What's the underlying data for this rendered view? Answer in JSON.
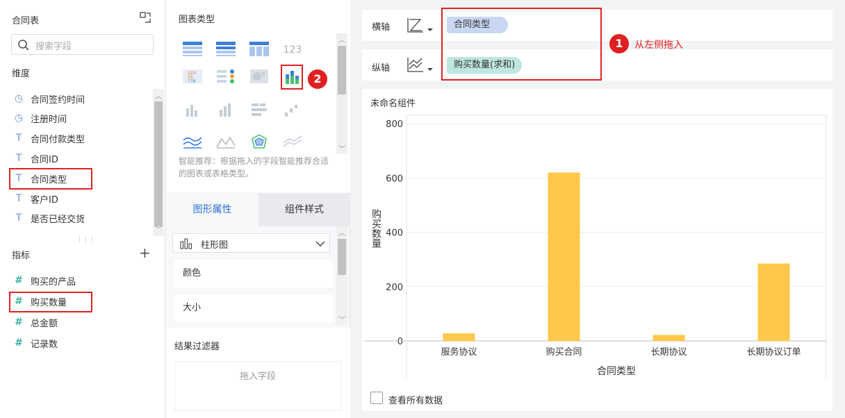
{
  "left": {
    "title": "合同表",
    "search_placeholder": "搜索字段",
    "dimensions_label": "维度",
    "dimensions": [
      {
        "icon": "clock-icon",
        "label": "合同签约时间"
      },
      {
        "icon": "clock-icon",
        "label": "注册时间"
      },
      {
        "icon": "text-type-icon",
        "label": "合同付款类型"
      },
      {
        "icon": "text-type-icon",
        "label": "合同ID"
      },
      {
        "icon": "text-type-icon",
        "label": "合同类型"
      },
      {
        "icon": "text-type-icon",
        "label": "客户ID"
      },
      {
        "icon": "text-type-icon",
        "label": "是否已经交货"
      }
    ],
    "measures_label": "指标",
    "measures": [
      {
        "icon": "hash-icon",
        "label": "购买的产品"
      },
      {
        "icon": "hash-icon",
        "label": "购买数量"
      },
      {
        "icon": "hash-icon",
        "label": "总金额"
      },
      {
        "icon": "hash-icon",
        "label": "记录数"
      }
    ]
  },
  "middle": {
    "chart_types_label": "图表类型",
    "smart_hint": "智能推荐：根据拖入的字段智能推荐合适的图表或表格类型。",
    "tabs": [
      "图形属性",
      "组件样式"
    ],
    "chart_type_select": "柱形图",
    "props": [
      "颜色",
      "大小"
    ],
    "filter_label": "结果过滤器",
    "filter_drop": "拖入字段",
    "callout_2": "2"
  },
  "axes": {
    "x_label": "横轴",
    "x_field": "合同类型",
    "y_label": "纵轴",
    "y_field": "购买数量(求和)",
    "callout_1": "1",
    "callout_text": "从左侧拖入"
  },
  "component": {
    "title": "未命名组件",
    "view_all": "查看所有数据"
  },
  "chart_data": {
    "type": "bar",
    "categories": [
      "服务协议",
      "购买合同",
      "长期协议",
      "长期协议订单"
    ],
    "values": [
      28,
      620,
      22,
      285
    ],
    "xlabel": "合同类型",
    "ylabel": "购买数量",
    "ylim": [
      0,
      800
    ],
    "yticks": [
      0,
      200,
      400,
      600,
      800
    ],
    "bar_color": "#ffc84a"
  },
  "colors": {
    "accent_red": "#e02020",
    "x_pill": "#c9d7f3",
    "y_pill": "#bfe6df",
    "bar": "#ffc84a"
  }
}
